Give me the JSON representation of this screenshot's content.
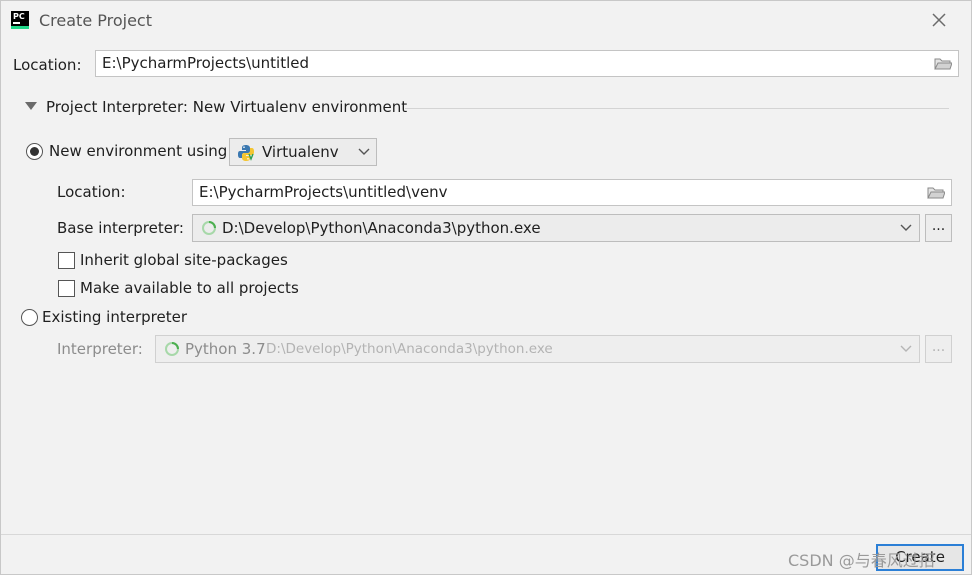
{
  "window": {
    "title": "Create Project",
    "app_logo_text": "PC",
    "close_icon": "close-icon"
  },
  "project": {
    "location_label": "Location:",
    "location_value": "E:\\PycharmProjects\\untitled"
  },
  "interpreter_section": {
    "header": "Project Interpreter: New Virtualenv environment",
    "new_env": {
      "radio_label": "New environment using",
      "selected": true,
      "env_tool": "Virtualenv",
      "location_label": "Location:",
      "location_value": "E:\\PycharmProjects\\untitled\\venv",
      "base_label": "Base interpreter:",
      "base_value": "D:\\Develop\\Python\\Anaconda3\\python.exe",
      "browse_label": "...",
      "inherit_label": "Inherit global site-packages",
      "inherit_checked": false,
      "make_available_label": "Make available to all projects",
      "make_available_checked": false
    },
    "existing": {
      "radio_label": "Existing interpreter",
      "selected": false,
      "interpreter_label": "Interpreter:",
      "interpreter_name": "Python 3.7",
      "interpreter_path": "D:\\Develop\\Python\\Anaconda3\\python.exe",
      "browse_label": "..."
    }
  },
  "footer": {
    "create_label": "Create",
    "watermark": "CSDN @与春风过招"
  },
  "colors": {
    "accent": "#2b7fd6",
    "background": "#f2f2f2",
    "spinner": "#4caf50"
  }
}
